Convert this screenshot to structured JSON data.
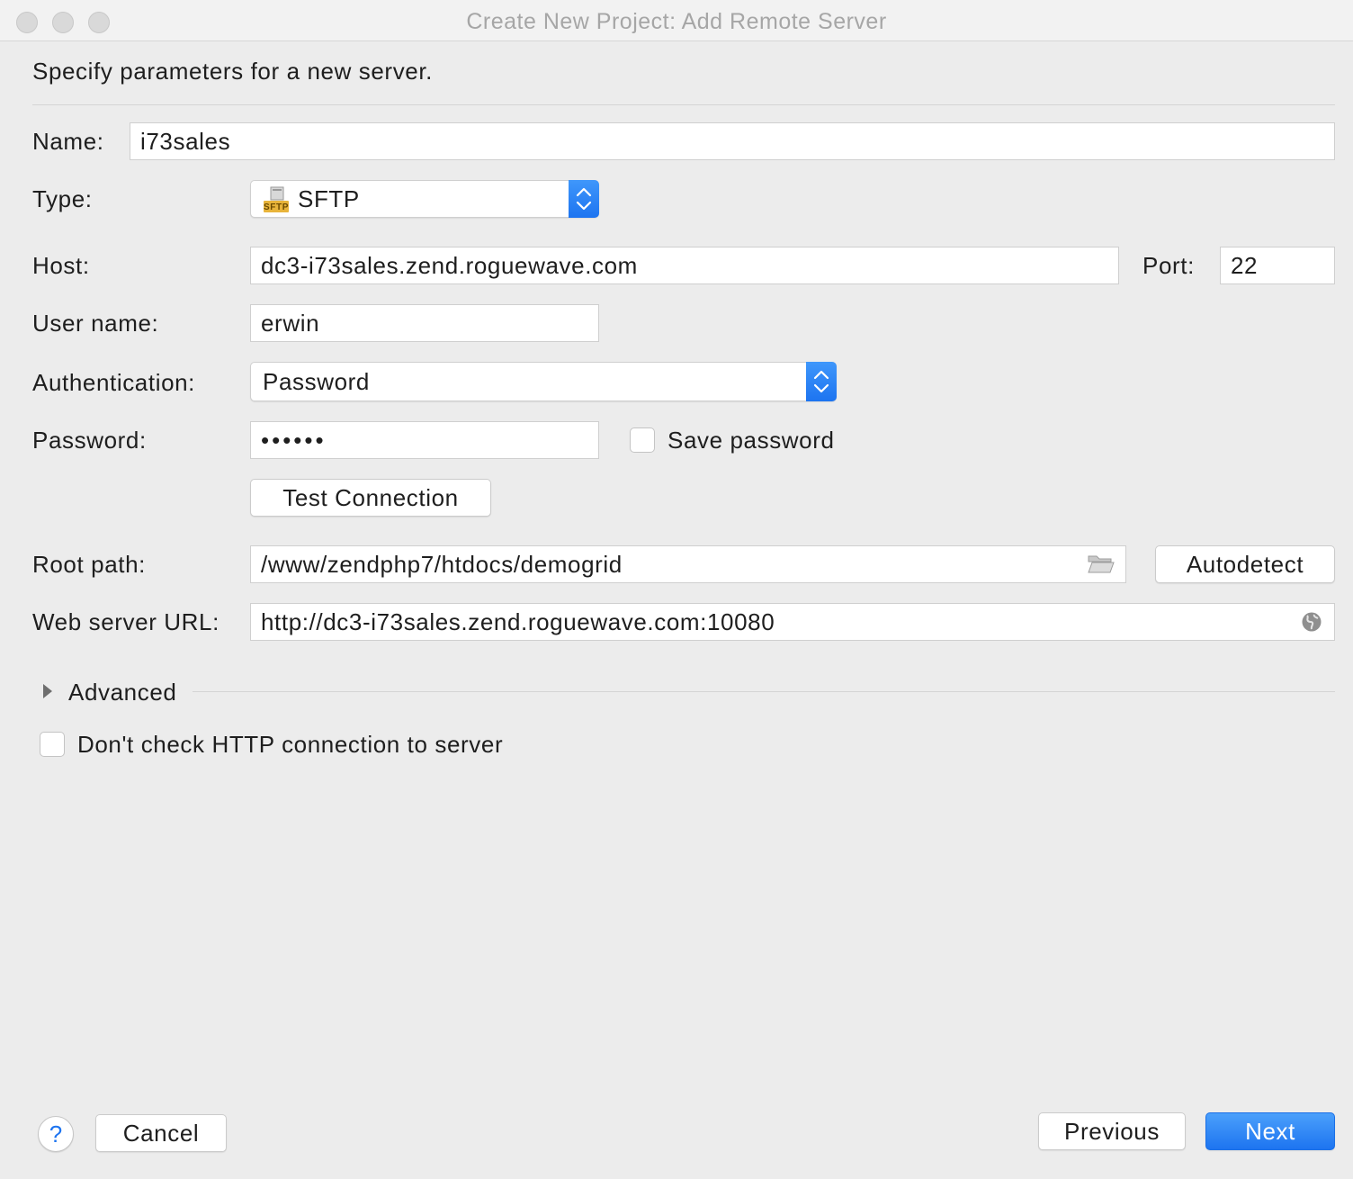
{
  "window": {
    "title": "Create New Project: Add Remote Server"
  },
  "header": {
    "description": "Specify parameters for a new server."
  },
  "form": {
    "name_label": "Name:",
    "name_value": "i73sales",
    "type_label": "Type:",
    "type_value": "SFTP",
    "type_icon_text": "SFTP",
    "host_label": "Host:",
    "host_value": "dc3-i73sales.zend.roguewave.com",
    "port_label": "Port:",
    "port_value": "22",
    "username_label": "User name:",
    "username_value": "erwin",
    "auth_label": "Authentication:",
    "auth_value": "Password",
    "password_label": "Password:",
    "password_value": "••••••",
    "save_password_label": "Save password",
    "save_password_checked": false,
    "test_connection_label": "Test Connection",
    "root_path_label": "Root path:",
    "root_path_value": "/www/zendphp7/htdocs/demogrid",
    "autodetect_label": "Autodetect",
    "web_url_label": "Web server URL:",
    "web_url_value": "http://dc3-i73sales.zend.roguewave.com:10080",
    "advanced_label": "Advanced",
    "dont_check_label": "Don't check HTTP connection to server",
    "dont_check_checked": false
  },
  "footer": {
    "help_label": "?",
    "cancel_label": "Cancel",
    "previous_label": "Previous",
    "next_label": "Next"
  },
  "colors": {
    "accent": "#1d74f0",
    "window_bg": "#ececec"
  },
  "icons": [
    "sftp-icon",
    "chevron-updown-icon",
    "folder-icon",
    "globe-icon",
    "disclosure-triangle-icon",
    "help-icon"
  ]
}
